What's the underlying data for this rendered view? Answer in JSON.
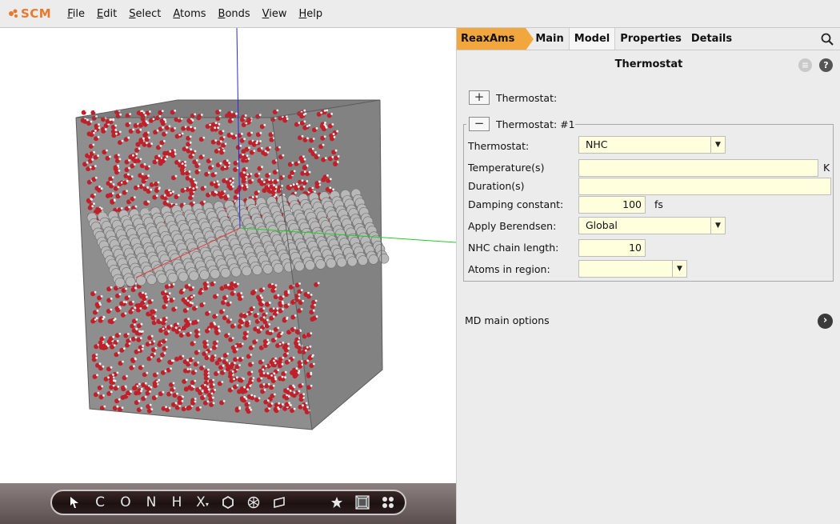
{
  "app": {
    "logo_text": "SCM",
    "accent": "#e9792b"
  },
  "menu": [
    {
      "id": "file",
      "label": "File"
    },
    {
      "id": "edit",
      "label": "Edit"
    },
    {
      "id": "select",
      "label": "Select"
    },
    {
      "id": "atoms",
      "label": "Atoms"
    },
    {
      "id": "bonds",
      "label": "Bonds"
    },
    {
      "id": "view",
      "label": "View"
    },
    {
      "id": "help",
      "label": "Help"
    }
  ],
  "tabs": {
    "breadcrumb": "ReaxAms",
    "main": "Main",
    "model": "Model",
    "properties": "Properties",
    "details": "Details",
    "active": "Model"
  },
  "panel": {
    "title": "Thermostat",
    "add_label": "Thermostat:",
    "group_label": "Thermostat: #1",
    "fields": {
      "thermostat": {
        "label": "Thermostat:",
        "value": "NHC"
      },
      "temperature": {
        "label": "Temperature(s)",
        "value": "",
        "unit": "K"
      },
      "duration": {
        "label": "Duration(s)",
        "value": ""
      },
      "damping": {
        "label": "Damping constant:",
        "value": "100",
        "unit": "fs"
      },
      "berendsen": {
        "label": "Apply Berendsen:",
        "value": "Global"
      },
      "nhc_chain": {
        "label": "NHC chain length:",
        "value": "10"
      },
      "region": {
        "label": "Atoms in region:",
        "value": ""
      }
    },
    "md_main_options": "MD main options"
  },
  "toolbar": {
    "tools": [
      "C",
      "O",
      "N",
      "H",
      "X"
    ]
  },
  "colors": {
    "field_bg": "#ffffdd",
    "crumb": "#f1a73e",
    "oxygen": "#c0202a",
    "slab": "#a9a9a9"
  }
}
